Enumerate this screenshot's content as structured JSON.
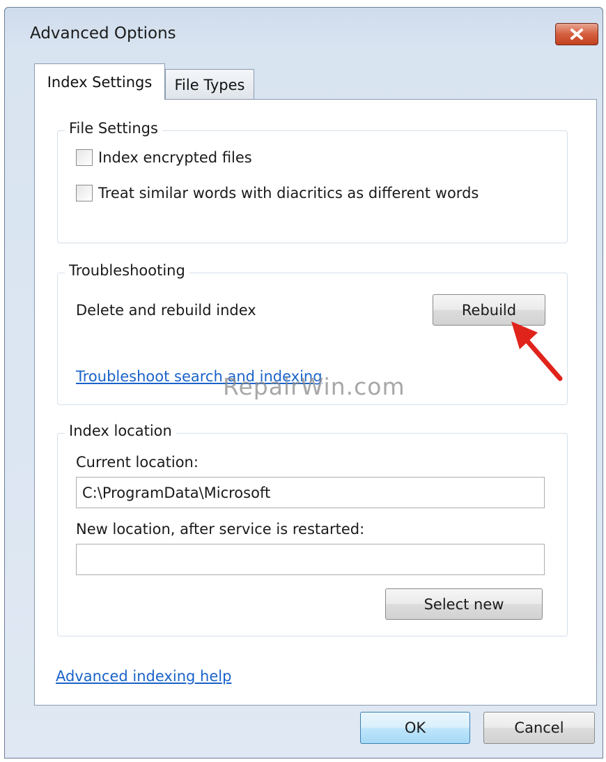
{
  "window": {
    "title": "Advanced Options",
    "close_icon": "close-icon"
  },
  "tabs": [
    {
      "label": "Index Settings",
      "active": true
    },
    {
      "label": "File Types",
      "active": false
    }
  ],
  "file_settings": {
    "title": "File Settings",
    "options": [
      {
        "label": "Index encrypted files",
        "checked": false
      },
      {
        "label": "Treat similar words with diacritics as different words",
        "checked": false
      }
    ]
  },
  "troubleshooting": {
    "title": "Troubleshooting",
    "delete_rebuild_label": "Delete and rebuild index",
    "rebuild_button": "Rebuild",
    "troubleshoot_link": "Troubleshoot search and indexing"
  },
  "index_location": {
    "title": "Index location",
    "current_label": "Current location:",
    "current_value": "C:\\ProgramData\\Microsoft",
    "new_label": "New location, after service is restarted:",
    "new_value": "",
    "select_button": "Select new"
  },
  "advanced_help_link": "Advanced indexing help",
  "footer": {
    "ok": "OK",
    "cancel": "Cancel"
  },
  "watermark": "RepairWin.com",
  "annotation": {
    "icon": "red-arrow-icon",
    "color": "#e0231b"
  },
  "colors": {
    "link": "#1a63c9",
    "window_frame": "#dfe8f3",
    "close_button": "#c94a2a"
  }
}
